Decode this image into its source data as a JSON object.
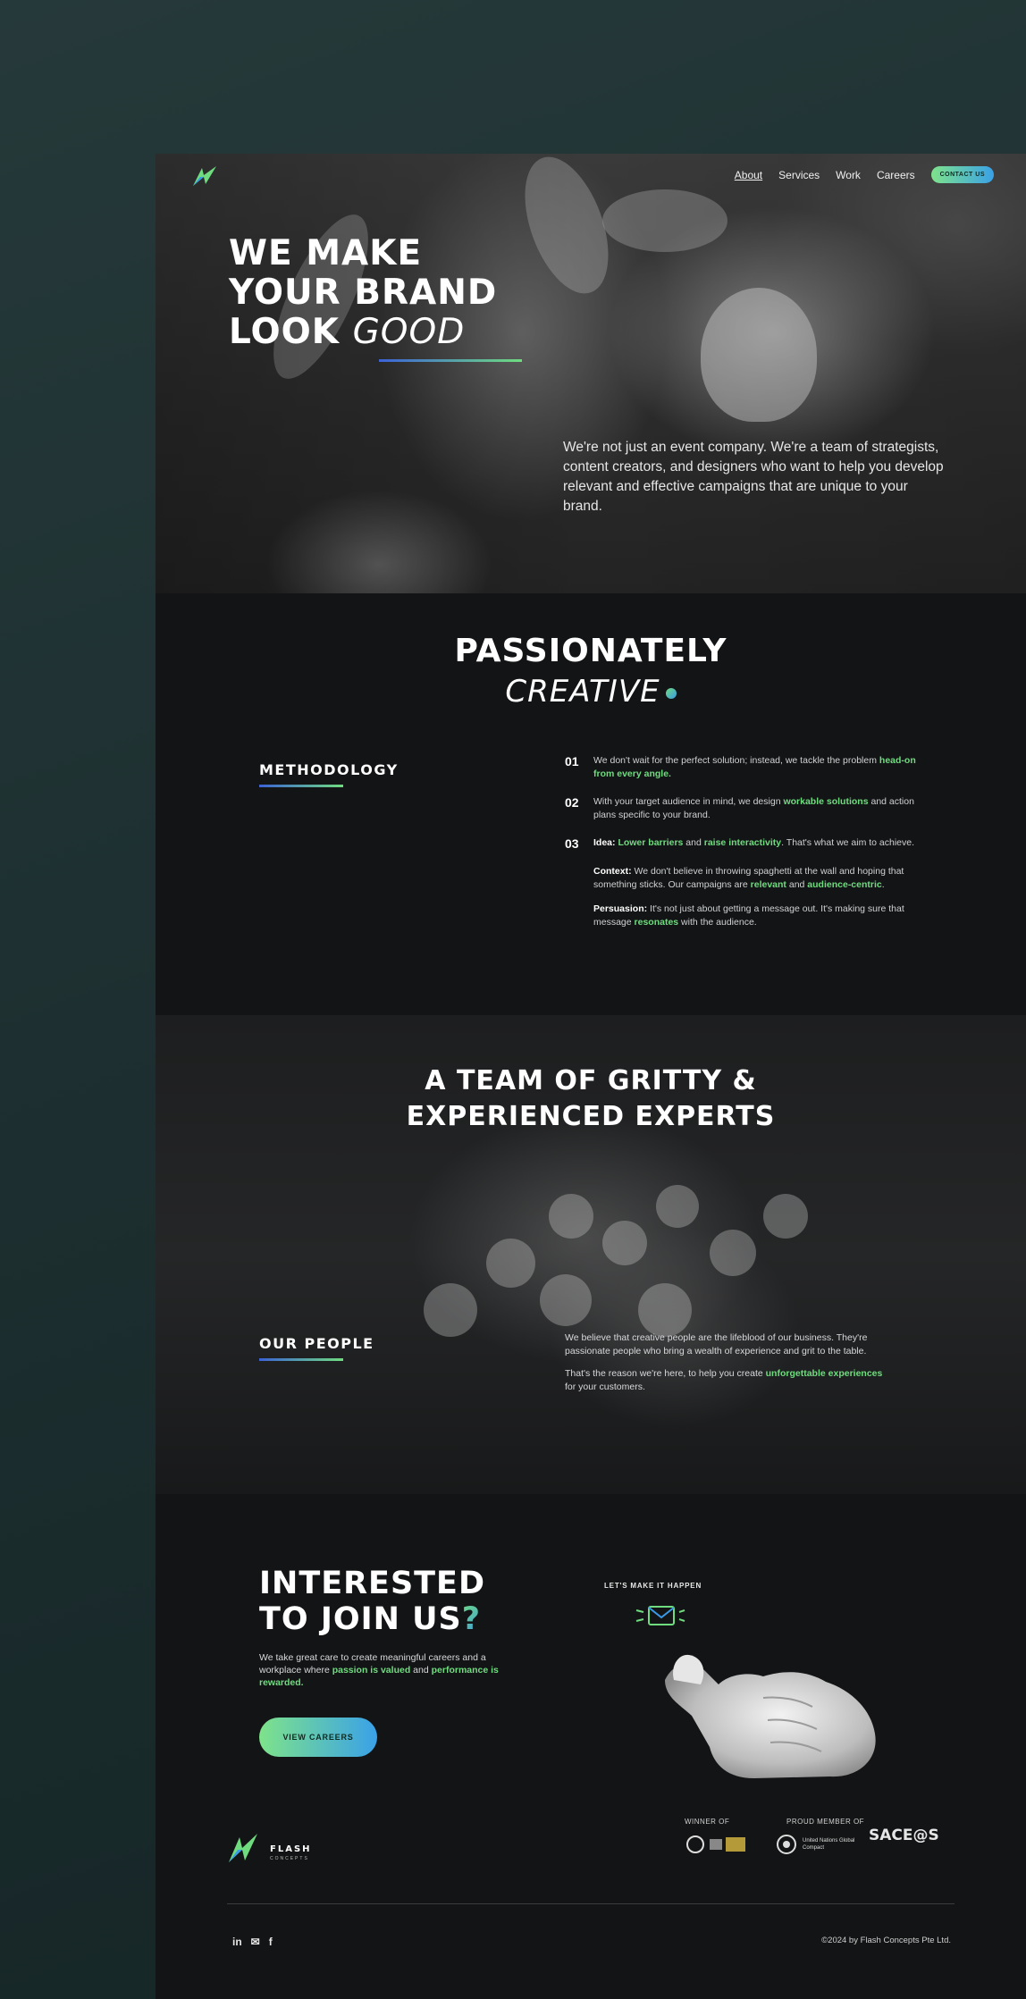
{
  "nav": {
    "items": [
      "About",
      "Services",
      "Work",
      "Careers"
    ],
    "active": "About",
    "contact_label": "CONTACT US"
  },
  "hero": {
    "title_line1": "WE MAKE",
    "title_line2": "YOUR BRAND",
    "title_line3_a": "LOOK ",
    "title_line3_b": "GOOD",
    "description": "We're not just an event company. We're a team of strategists, content creators, and designers who want to help you develop relevant and effective campaigns that are unique to your brand."
  },
  "passion": {
    "title": "PASSIONATELY",
    "subtitle": "CREATIVE"
  },
  "methodology": {
    "label": "METHODOLOGY",
    "items": [
      {
        "num": "01",
        "a": "We don't wait for the perfect solution; instead, we tackle the problem ",
        "hl": "head-on from every angle."
      },
      {
        "num": "02",
        "a": "With your target audience in mind, we design ",
        "hl": "workable solutions",
        "b": " and action plans specific to your brand."
      },
      {
        "num": "03",
        "bold": "Idea: ",
        "hl1": "Lower barriers",
        "mid": " and ",
        "hl2": "raise interactivity",
        "tail": ". That's what we aim to achieve."
      }
    ],
    "context": {
      "bold": "Context: ",
      "a": "We don't believe in throwing spaghetti at the wall and hoping that something sticks. Our campaigns are ",
      "hl1": "relevant",
      "mid": " and ",
      "hl2": "audience-centric",
      "tail": "."
    },
    "persuasion": {
      "bold": "Persuasion: ",
      "a": "It's not just about getting a message out. It's making sure that message ",
      "hl": "resonates",
      "tail": " with the audience."
    }
  },
  "team": {
    "title_line1": "A TEAM OF GRITTY &",
    "title_line2": "EXPERIENCED EXPERTS",
    "label": "OUR PEOPLE",
    "p1": "We believe that creative people are the lifeblood of our business.  They're passionate people who bring a wealth of experience and grit to the table.",
    "p2_a": "That's the reason we're here, to help you create ",
    "p2_hl": "unforgettable experiences",
    "p2_b": " for your customers."
  },
  "join": {
    "title_line1": "INTERESTED",
    "title_line2": "TO JOIN US",
    "qmark": "?",
    "text_a": "We take great care to create meaningful careers and a workplace where ",
    "text_hl1": "passion is valued",
    "text_mid": " and ",
    "text_hl2": "performance is rewarded.",
    "button": "VIEW CAREERS",
    "cta_label": "LET'S MAKE IT HAPPEN"
  },
  "footer": {
    "logo_word": "FLASH",
    "logo_sub": "CONCEPTS",
    "winner_label": "WINNER OF",
    "member_label": "PROUD MEMBER OF",
    "un_label": "United Nations Global Compact",
    "sace_label": "SACE@S",
    "socials": [
      "in",
      "✉",
      "f"
    ],
    "copyright": "©2024 by Flash Concepts Pte Ltd."
  },
  "colors": {
    "accent_green": "#6fdc7f",
    "accent_blue": "#3a9ae8",
    "page_bg": "#131415",
    "outer_bg": "#22393a"
  }
}
